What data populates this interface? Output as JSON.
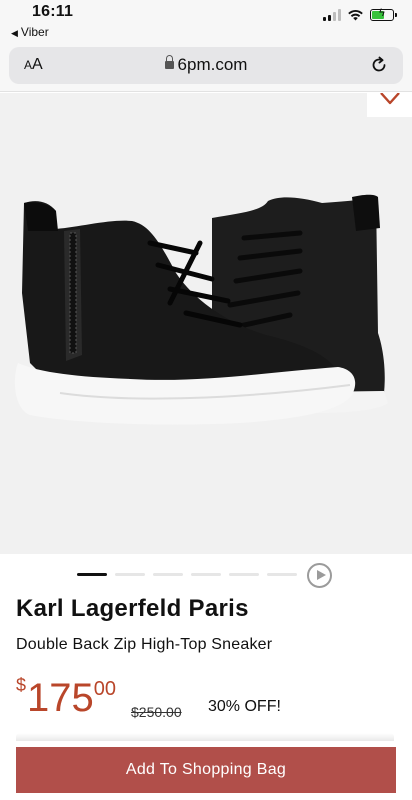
{
  "status_bar": {
    "time": "16:11",
    "back_app": "Viber",
    "back_icon": "back-triangle-icon",
    "colors": {
      "battery_fill": "#37c23b"
    }
  },
  "browser": {
    "text_size_label": "AA",
    "url": "6pm.com",
    "lock_icon": "lock-icon",
    "reload_icon": "reload-icon"
  },
  "product": {
    "favorite_icon": "heart-icon",
    "brand": "Karl Lagerfeld Paris",
    "name": "Double Back Zip High-Top Sneaker",
    "price": {
      "currency": "$",
      "dollars": "175",
      "cents": "00"
    },
    "original_price": "$250.00",
    "discount": "30% OFF!"
  },
  "carousel": {
    "slide_count": 6,
    "active_index": 0,
    "video_icon": "play-icon"
  },
  "actions": {
    "add_to_bag": "Add To Shopping Bag"
  },
  "colors": {
    "price": "#b9462a",
    "button": "#b14f4a",
    "image_bg": "#f1f1f1"
  }
}
